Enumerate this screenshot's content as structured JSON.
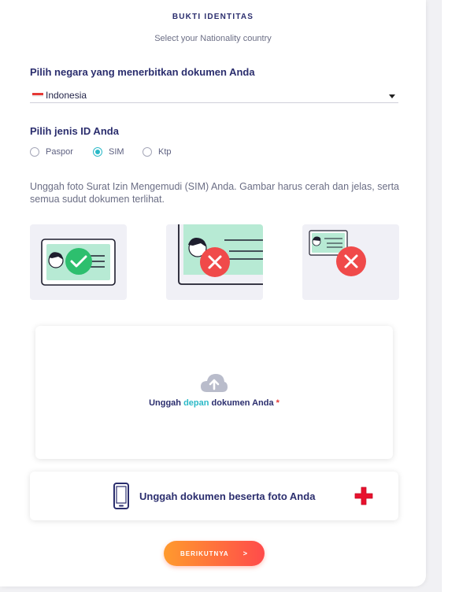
{
  "header": {
    "title": "BUKTI IDENTITAS",
    "subtitle": "Select your Nationality country"
  },
  "country": {
    "label": "Pilih negara yang menerbitkan dokumen Anda",
    "selected": "Indonesia",
    "flag_icon": "indonesia-flag-icon"
  },
  "id_type": {
    "label": "Pilih jenis ID Anda",
    "options": [
      {
        "label": "Paspor",
        "checked": false
      },
      {
        "label": "SIM",
        "checked": true
      },
      {
        "label": "Ktp",
        "checked": false
      }
    ]
  },
  "instructions": "Unggah foto Surat Izin Mengemudi (SIM) Anda. Gambar harus cerah dan jelas, serta semua sudut dokumen terlihat.",
  "examples": [
    {
      "status": "correct",
      "icon": "check-icon"
    },
    {
      "status": "wrong",
      "icon": "cross-icon"
    },
    {
      "status": "wrong",
      "icon": "cross-icon"
    }
  ],
  "upload_front": {
    "text_before": "Unggah ",
    "text_accent": "depan",
    "text_after": " dokumen Anda",
    "required_mark": "*",
    "icon": "cloud-upload-icon"
  },
  "upload_selfie": {
    "text": "Unggah dokumen beserta foto Anda",
    "icon": "phone-icon",
    "add_icon": "plus-icon"
  },
  "next_button": {
    "label": "BERIKUTNYA",
    "chevron": ">"
  },
  "colors": {
    "navy": "#2b2e6e",
    "teal": "#2bb9c7",
    "green": "#2dbf6e",
    "red": "#f04a4a",
    "orange": "#ff9a2e",
    "id_card_bg": "#b7ead4"
  }
}
